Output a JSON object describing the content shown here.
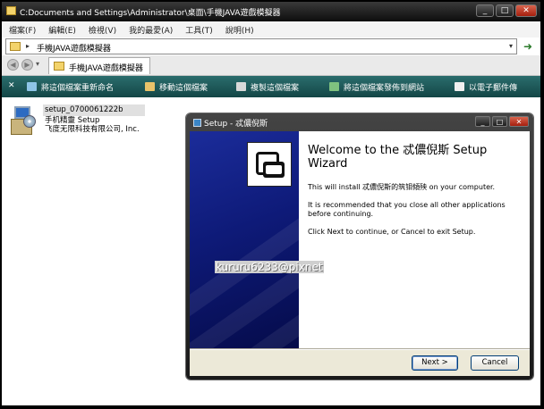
{
  "window": {
    "title": "C:Documents and Settings\\Administrator\\桌面\\手機JAVA遊戲模擬器",
    "controls": {
      "minimize": "_",
      "maximize": "□",
      "close": "✕"
    }
  },
  "menubar": {
    "items": [
      "檔案(F)",
      "編輯(E)",
      "檢視(V)",
      "我的最愛(A)",
      "工具(T)",
      "說明(H)"
    ]
  },
  "address": {
    "separator": "▸",
    "path": "手機JAVA遊戲模擬器",
    "dropdown": "▾",
    "go": "➜"
  },
  "nav": {
    "back": "◀",
    "forward": "▶",
    "dropdown": "▾",
    "tab_label": "手機JAVA遊戲模擬器"
  },
  "taskpane": {
    "close": "✕",
    "tasks": [
      {
        "label": "將這個檔案重新命名",
        "color": "#8ec5e8",
        "icon": "rename-icon"
      },
      {
        "label": "移動這個檔案",
        "color": "#e9c36a",
        "icon": "move-icon"
      },
      {
        "label": "複製這個檔案",
        "color": "#d8d8d8",
        "icon": "copy-icon"
      },
      {
        "label": "將這個檔案發佈到網站",
        "color": "#7fc27f",
        "icon": "publish-icon"
      },
      {
        "label": "以電子郵件傳",
        "color": "#f0f0f0",
        "icon": "email-icon"
      }
    ]
  },
  "file": {
    "name": "setup_0700061222b",
    "desc": "手机精靈 Setup",
    "company": "飞度无限科技有限公司, Inc."
  },
  "dialog": {
    "title": "Setup - 忒儂倪斯",
    "controls": {
      "minimize": "_",
      "maximize": "□",
      "close": "✕"
    },
    "heading": "Welcome to the 忒儂倪斯 Setup Wizard",
    "p1": "This will install 忒儂倪斯的筑钼傾殃 on your computer.",
    "p2": "It is recommended that you close all other applications before continuing.",
    "p3": "Click Next to continue, or Cancel to exit Setup.",
    "next_label": "Next >",
    "cancel_label": "Cancel"
  },
  "watermark": "kururu6233@pixnet"
}
